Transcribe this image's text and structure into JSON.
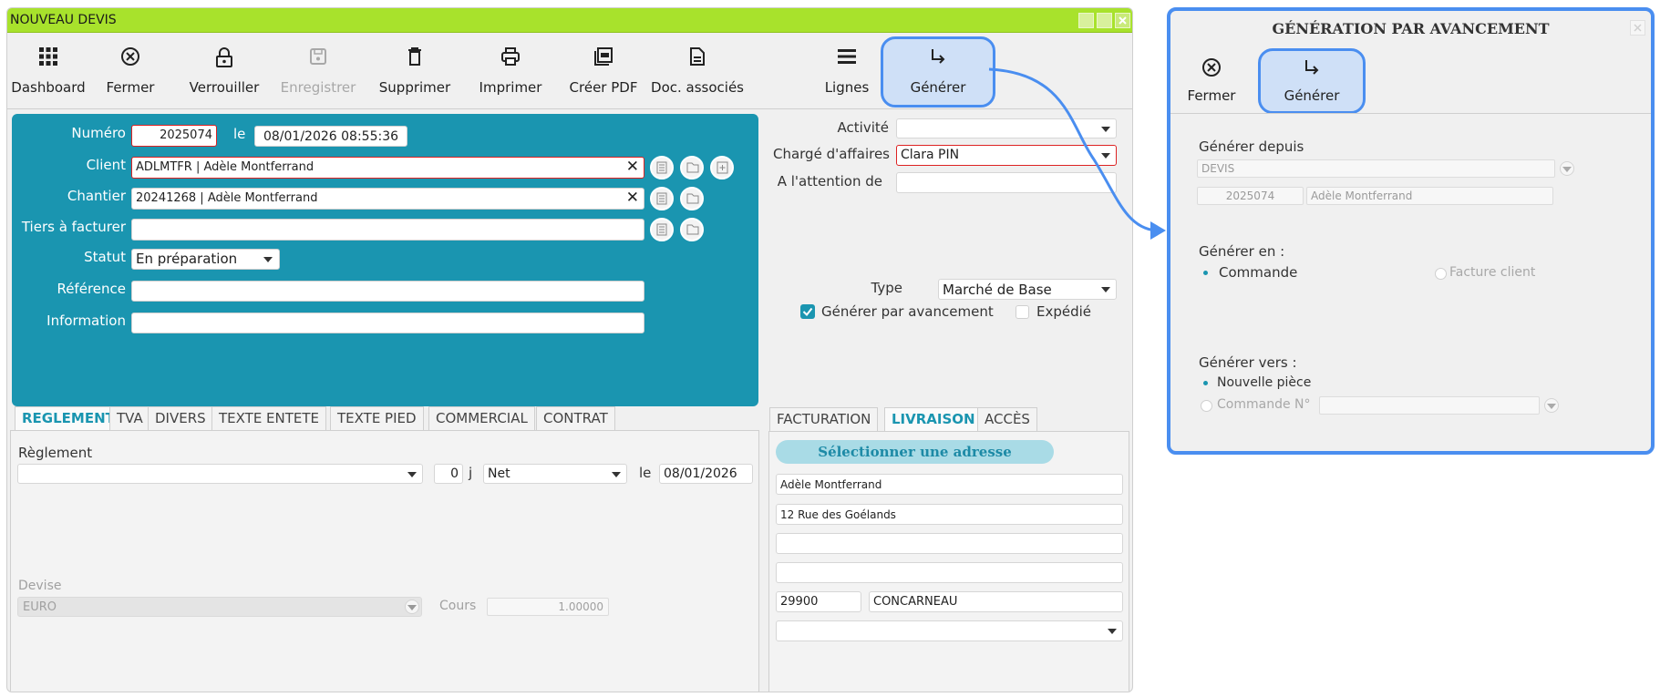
{
  "main_window": {
    "title": "NOUVEAU DEVIS",
    "toolbar": {
      "dashboard": "Dashboard",
      "close": "Fermer",
      "lock": "Verrouiller",
      "save": "Enregistrer",
      "delete": "Supprimer",
      "print": "Imprimer",
      "create_pdf": "Créer PDF",
      "docs": "Doc. associés",
      "lines": "Lignes",
      "generate": "Générer"
    },
    "form": {
      "numero_label": "Numéro",
      "numero_value": "2025074",
      "le_label": "le",
      "date_value": "08/01/2026 08:55:36",
      "client_label": "Client",
      "client_value": "ADLMTFR | Adèle Montferrand",
      "chantier_label": "Chantier",
      "chantier_value": "20241268 | Adèle Montferrand",
      "tiers_label": "Tiers à facturer",
      "tiers_value": "",
      "statut_label": "Statut",
      "statut_value": "En préparation",
      "reference_label": "Référence",
      "reference_value": "",
      "information_label": "Information",
      "information_value": ""
    },
    "right_form": {
      "activite_label": "Activité",
      "activite_value": "",
      "charge_label": "Chargé d'affaires",
      "charge_value": "Clara PIN",
      "attention_label": "A l'attention de",
      "attention_value": "",
      "type_label": "Type",
      "type_value": "Marché de Base",
      "gen_avancement_label": "Générer par avancement",
      "gen_avancement_checked": true,
      "expedie_label": "Expédié",
      "expedie_checked": false
    },
    "tabs_left": [
      "REGLEMENT",
      "TVA",
      "DIVERS",
      "TEXTE ENTETE",
      "TEXTE PIED",
      "COMMERCIAL",
      "CONTRAT"
    ],
    "reglement": {
      "label": "Règlement",
      "value": "",
      "days": "0",
      "days_unit": "j",
      "term": "Net",
      "le_label": "le",
      "date": "08/01/2026",
      "devise_label": "Devise",
      "devise_value": "EURO",
      "cours_label": "Cours",
      "cours_value": "1.00000"
    },
    "tabs_right": [
      "FACTURATION",
      "LIVRAISON",
      "ACCÈS"
    ],
    "livraison": {
      "select_address": "Sélectionner une adresse",
      "name": "Adèle Montferrand",
      "street": "12 Rue des Goélands",
      "line3": "",
      "line4": "",
      "postcode": "29900",
      "city": "CONCARNEAU",
      "country": ""
    }
  },
  "dialog": {
    "title": "GÉNÉRATION PAR AVANCEMENT",
    "close": "Fermer",
    "generate": "Générer",
    "from_label": "Générer depuis",
    "from_type": "DEVIS",
    "from_number": "2025074",
    "from_name": "Adèle Montferrand",
    "in_label": "Générer en :",
    "in_option_1": "Commande",
    "in_option_2": "Facture client",
    "to_label": "Générer vers :",
    "to_option_1": "Nouvelle pièce",
    "to_option_2": "Commande N°",
    "to_order_value": ""
  },
  "colors": {
    "titlebar": "#a8e22c",
    "panel": "#1a95b0",
    "highlight": "#4a8ef0",
    "highlight_fill": "#cfe0f7"
  }
}
